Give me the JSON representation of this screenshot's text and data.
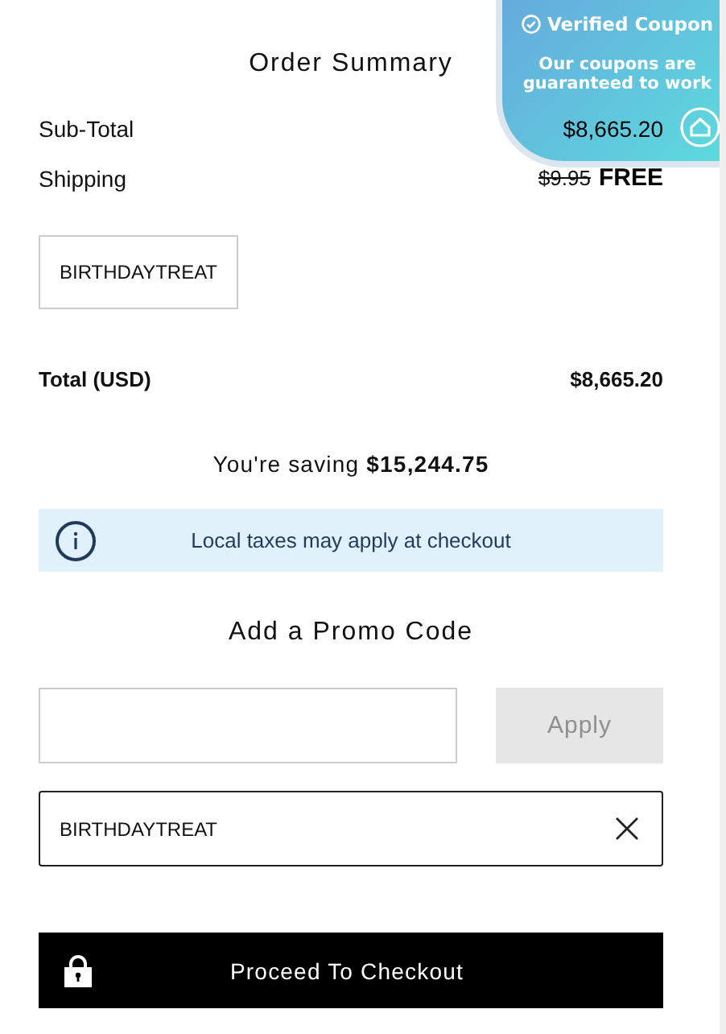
{
  "title": "Order Summary",
  "lines": [
    {
      "label": "Sub-Total",
      "value": "$8,665.20"
    },
    {
      "label": "Shipping",
      "original_price": "$9.95",
      "value": "FREE"
    }
  ],
  "applied_codes": [
    "BIRTHDAYTREAT"
  ],
  "total": {
    "label": "Total (USD)",
    "value": "$8,665.20"
  },
  "savings": "You're saving **$15,244.75**",
  "notice": {
    "text": "Local taxes may apply at checkout"
  },
  "promo": {
    "heading": "Add a Promo Code",
    "apply_button": {
      "label": "Apply",
      "disabled": true
    }
  },
  "applied_code_field": {
    "value": "BIRTHDAYTREAT"
  },
  "checkout_button": {
    "label": "Proceed To Checkout"
  },
  "coupon_badge": {
    "title": "Verified Coupon",
    "text": "Our coupons are guaranteed to work"
  }
}
